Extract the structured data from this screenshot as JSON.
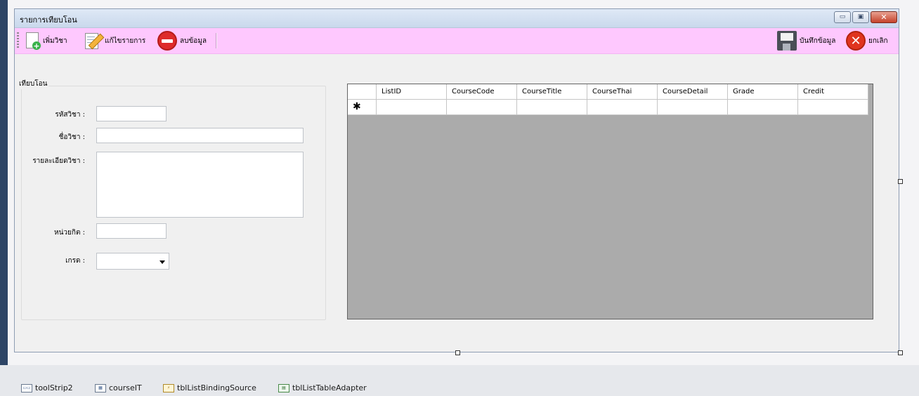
{
  "form": {
    "title": "รายการเทียบโอน",
    "window_buttons": {
      "minimize": "▭",
      "maximize": "▣",
      "close": "✕"
    }
  },
  "toolbar": {
    "add_label": "เพิ่มวิชา",
    "edit_label": "แก้ไขรายการ",
    "delete_label": "ลบข้อมูล",
    "save_label": "บันทึกข้อมูล",
    "cancel_label": "ยกเลิก",
    "background_color": "#fec8fe"
  },
  "group": {
    "title": "เทียบโอน",
    "fields": {
      "course_code_label": "รหัสวิชา :",
      "course_name_label": "ชื่อวิชา :",
      "course_detail_label": "รายละเอียดวิชา :",
      "credit_label": "หน่วยกิต :",
      "grade_label": "เกรด :"
    },
    "values": {
      "course_code": "",
      "course_name": "",
      "course_detail": "",
      "credit": "",
      "grade": ""
    }
  },
  "grid": {
    "columns": [
      "ListID",
      "CourseCode",
      "CourseTitle",
      "CourseThai",
      "CourseDetail",
      "Grade",
      "Credit"
    ],
    "new_row_marker": "✱",
    "background_color": "#ababab"
  },
  "component_tray": {
    "items": [
      {
        "label": "toolStrip2",
        "icon": "toolstrip-icon"
      },
      {
        "label": "courseIT",
        "icon": "dataset-icon"
      },
      {
        "label": "tblListBindingSource",
        "icon": "binding-source-icon"
      },
      {
        "label": "tblListTableAdapter",
        "icon": "table-adapter-icon"
      }
    ]
  }
}
